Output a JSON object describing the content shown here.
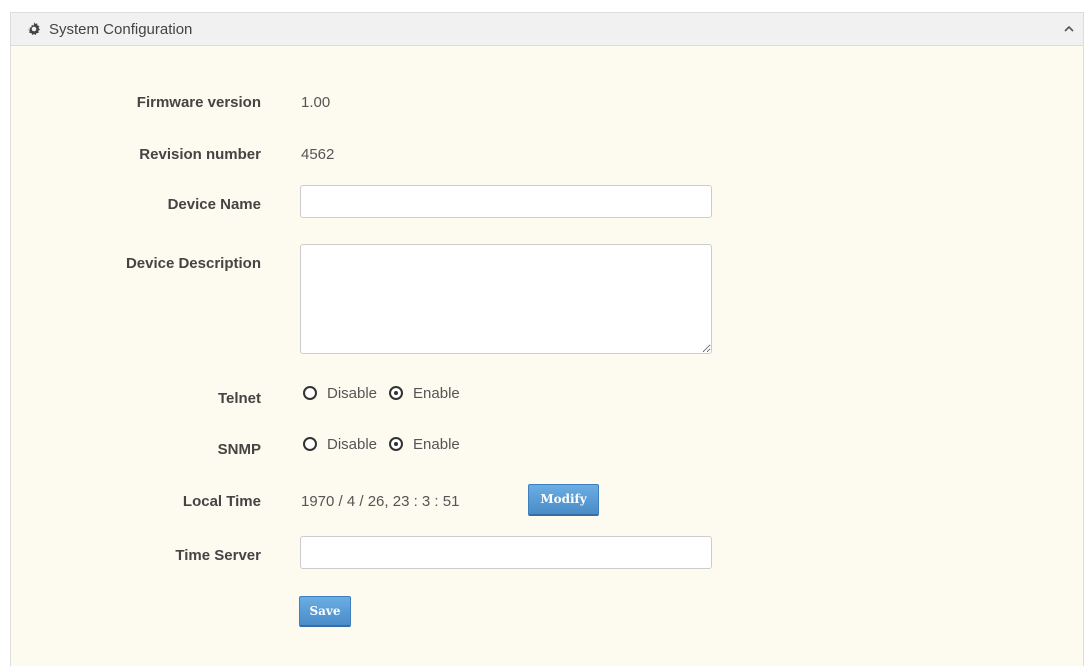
{
  "panel": {
    "title": "System Configuration",
    "header_icon": "gear-icon",
    "collapse_icon": "chevron-up-icon"
  },
  "fields": {
    "firmware_version": {
      "label": "Firmware version",
      "value": "1.00"
    },
    "revision_number": {
      "label": "Revision number",
      "value": "4562"
    },
    "device_name": {
      "label": "Device Name",
      "value": ""
    },
    "device_description": {
      "label": "Device Description",
      "value": ""
    },
    "telnet": {
      "label": "Telnet",
      "options": [
        "Disable",
        "Enable"
      ],
      "selected": "Enable"
    },
    "snmp": {
      "label": "SNMP",
      "options": [
        "Disable",
        "Enable"
      ],
      "selected": "Enable"
    },
    "local_time": {
      "label": "Local Time",
      "value": "1970 / 4 / 26, 23 : 3 : 51",
      "modify_label": "Modify"
    },
    "time_server": {
      "label": "Time Server",
      "value": ""
    }
  },
  "save_label": "Save",
  "colors": {
    "panel_bg": "#fdfaef",
    "header_bg": "#f1f1f1",
    "button": "#5b9bd5"
  }
}
